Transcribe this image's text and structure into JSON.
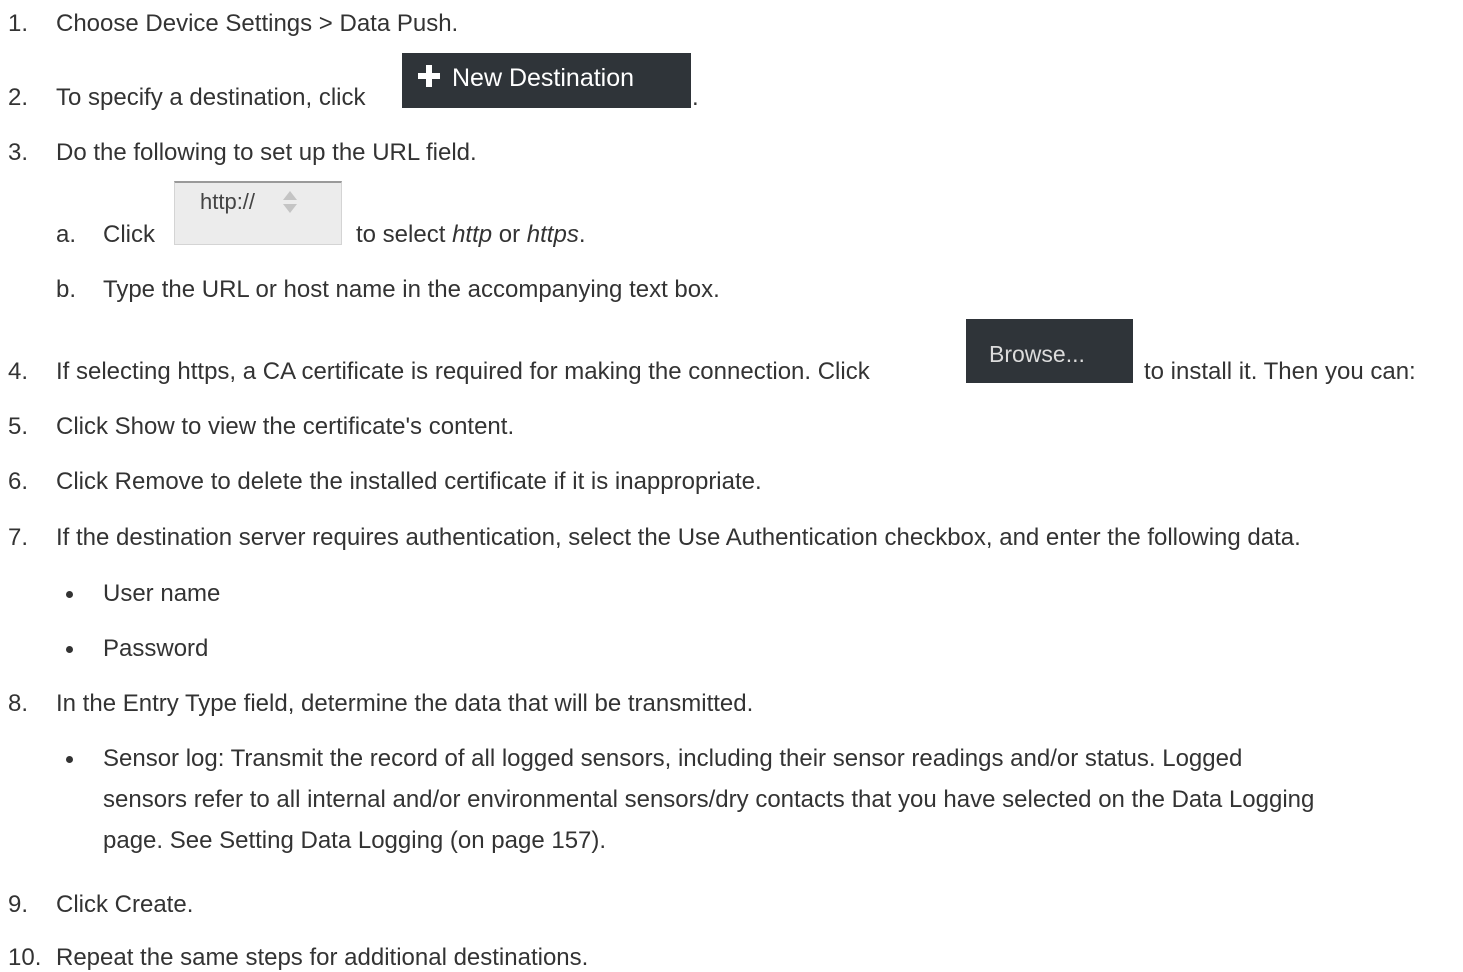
{
  "steps": {
    "s1": {
      "num": "1.",
      "text": "Choose Device Settings > Data Push."
    },
    "s2": {
      "num": "2.",
      "text_before": "To specify a destination, click",
      "button_label": "New Destination",
      "text_after": "."
    },
    "s3": {
      "num": "3.",
      "text": "Do the following to set up the URL field."
    },
    "s3a": {
      "letter": "a.",
      "text_before": "Click",
      "select_value": "http://",
      "text_mid": "to select",
      "opt1": "http",
      "or": "or",
      "opt2": "https",
      "end": "."
    },
    "s3b": {
      "letter": "b.",
      "text": "Type the URL or host name in the accompanying text box."
    },
    "s4": {
      "num": "4.",
      "text_before": "If selecting https, a CA certificate is required for making the connection. Click",
      "button_label": "Browse...",
      "text_after": "to install it. Then you can:"
    },
    "s5": {
      "num": "5.",
      "text": "Click Show to view the certificate's content."
    },
    "s6": {
      "num": "6.",
      "text": "Click Remove to delete the installed certificate if it is inappropriate."
    },
    "s7": {
      "num": "7.",
      "text": "If the destination server requires authentication, select the Use Authentication checkbox, and enter the following data."
    },
    "s7_bullets": [
      "User name",
      "Password"
    ],
    "s8": {
      "num": "8.",
      "text": "In the Entry Type field, determine the data that will be transmitted."
    },
    "s8_bullet": [
      "Sensor log: Transmit the record of all logged sensors, including their sensor readings and/or status. Logged",
      "sensors refer to all internal and/or environmental sensors/dry contacts that you have selected on the Data Logging",
      "page. See Setting Data Logging (on page 157)."
    ],
    "s9": {
      "num": "9.",
      "text": "Click Create."
    },
    "s10": {
      "num": "10.",
      "text": "Repeat the same steps for additional destinations."
    }
  },
  "icons": {
    "new_destination": "plus-icon",
    "select_arrows": "up-down-arrows-icon"
  },
  "colors": {
    "text": "#333333",
    "dark_button": "#2f3439",
    "select_bg": "#ececec"
  }
}
